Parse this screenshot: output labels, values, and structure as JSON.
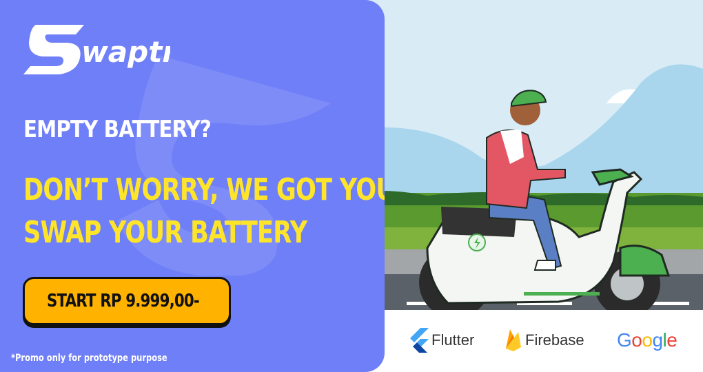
{
  "brand": {
    "name": "Swaptry"
  },
  "promo": {
    "headline": "EMPTY BATTERY?",
    "tagline_1": "DON’T WORRY, WE GOT YOU!",
    "tagline_2": "SWAP YOUR BATTERY",
    "cta_label": "START RP 9.999,00-",
    "footnote": "*Promo only for prototype purpose"
  },
  "tech_stack": {
    "flutter": "Flutter",
    "firebase": "Firebase",
    "google": [
      "G",
      "o",
      "o",
      "g",
      "l",
      "e"
    ]
  },
  "colors": {
    "panel": "#6f7ff7",
    "accent_yellow": "#ffe52a",
    "cta": "#ffb300",
    "sky": "#d9ecf6",
    "grass": "#5a9a2e",
    "road": "#5b6168",
    "scooter_green": "#4caf50"
  },
  "icons": [
    "flutter-logo-icon",
    "firebase-logo-icon",
    "swaptry-logo-icon",
    "battery-bolt-icon"
  ]
}
